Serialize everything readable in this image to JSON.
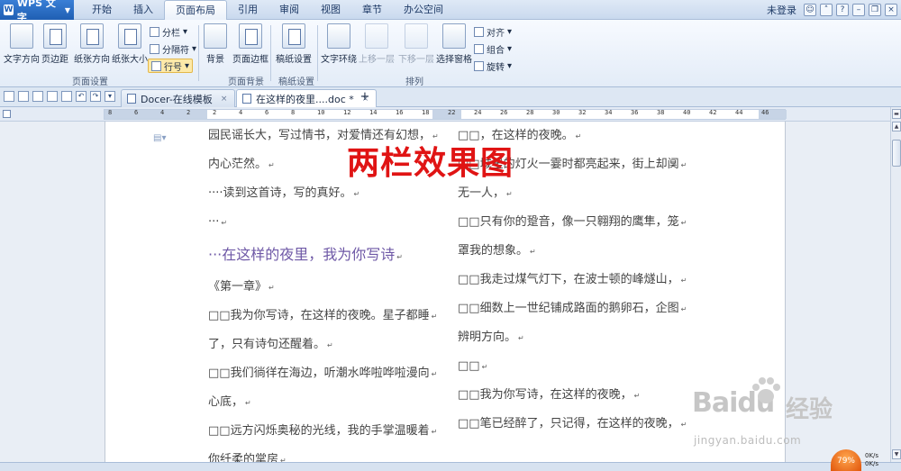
{
  "app": {
    "name": "WPS 文字"
  },
  "menu": {
    "tabs": [
      "开始",
      "插入",
      "页面布局",
      "引用",
      "审阅",
      "视图",
      "章节",
      "办公空间"
    ],
    "active_index": 2
  },
  "account": {
    "login_label": "未登录"
  },
  "ribbon": {
    "text_direction": "文字方向",
    "margins": "页边距",
    "orientation": "纸张方向",
    "size": "纸张大小",
    "columns": "分栏",
    "breaks": "分隔符",
    "line_numbers": "行号",
    "group_page_setup": "页面设置",
    "background": "背景",
    "page_border": "页面边框",
    "group_page_background": "页面背景",
    "manuscript": "稿纸设置",
    "group_manuscript": "稿纸设置",
    "text_wrap": "文字环绕",
    "bring_forward": "上移一层",
    "send_backward": "下移一层",
    "selection_pane": "选择窗格",
    "align": "对齐",
    "group": "组合",
    "rotate": "旋转",
    "group_arrange": "排列"
  },
  "doc_tabs": [
    "Docer-在线模板",
    "在这样的夜里....doc *"
  ],
  "ruler": {
    "labels": [
      "8",
      "6",
      "4",
      "2",
      "2",
      "4",
      "6",
      "8",
      "10",
      "12",
      "14",
      "16",
      "18",
      "22",
      "24",
      "26",
      "28",
      "30",
      "32",
      "34",
      "36",
      "38",
      "40",
      "42",
      "44",
      "46"
    ]
  },
  "doc": {
    "left_column": [
      "园民谣长大，写过情书，对爱情还有幻想，",
      "内心茫然。",
      "····读到这首诗，写的真好。",
      "···",
      "···在这样的夜里，我为你写诗",
      "《第一章》",
      "□□我为你写诗，在这样的夜晚。星子都睡",
      "了，只有诗句还醒着。",
      "□□我们徜徉在海边，听潮水哗啦哗啦漫向",
      "心底，",
      "□□远方闪烁奥秘的光线，我的手掌温暖着",
      "你纤柔的掌房"
    ],
    "right_column": [
      "□□，在这样的夜晚。",
      "□□城里的灯火一霎时都亮起来，街上却阒",
      "无一人，",
      "□□只有你的跫音，像一只翱翔的鹰隼，笼",
      "罩我的想象。",
      "□□我走过煤气灯下，在波士顿的峰燧山，",
      "□□细数上一世纪铺成路面的鹅卵石，企图",
      "辨明方向。",
      "□□",
      "□□我为你写诗，在这样的夜晚，",
      "□□笔已经醉了，只记得，在这样的夜晚，"
    ]
  },
  "overlay_title": "两栏效果图",
  "watermark": {
    "brand": "Baidu",
    "cn": "经验",
    "url": "jingyan.baidu.com"
  },
  "network": {
    "percent": "79%",
    "speed_up": "0K/s",
    "speed_down": "0K/s"
  },
  "colors": {
    "accent": "#1f5fb3",
    "overlay_title": "#e01414",
    "heading_purple": "#6e58a6"
  }
}
